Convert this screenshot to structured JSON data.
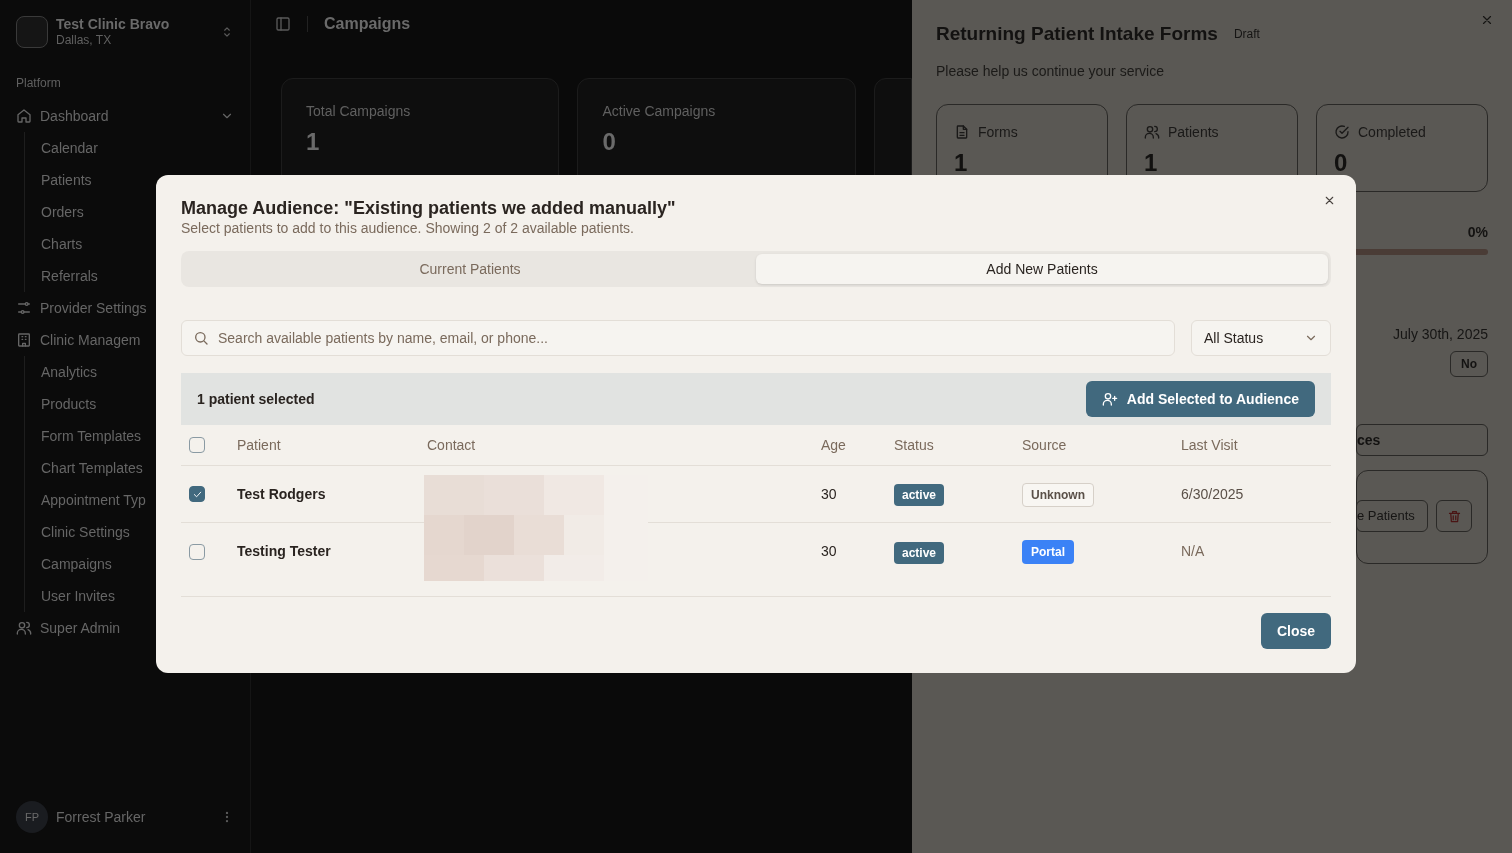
{
  "sidebar": {
    "clinic": {
      "name": "Test Clinic Bravo",
      "location": "Dallas, TX"
    },
    "section_label": "Platform",
    "items": [
      {
        "label": "Dashboard",
        "expanded": true,
        "children": [
          {
            "label": "Calendar"
          },
          {
            "label": "Patients"
          },
          {
            "label": "Orders"
          },
          {
            "label": "Charts"
          },
          {
            "label": "Referrals"
          }
        ]
      },
      {
        "label": "Provider Settings"
      },
      {
        "label": "Clinic Managem",
        "children": [
          {
            "label": "Analytics"
          },
          {
            "label": "Products"
          },
          {
            "label": "Form Templates"
          },
          {
            "label": "Chart Templates"
          },
          {
            "label": "Appointment Typ"
          },
          {
            "label": "Clinic Settings"
          },
          {
            "label": "Campaigns"
          },
          {
            "label": "User Invites"
          }
        ]
      },
      {
        "label": "Super Admin"
      }
    ],
    "user": {
      "initials": "FP",
      "name": "Forrest Parker"
    }
  },
  "header": {
    "title": "Campaigns"
  },
  "stats": [
    {
      "label": "Total Campaigns",
      "value": "1"
    },
    {
      "label": "Active Campaigns",
      "value": "0"
    }
  ],
  "sheet": {
    "title": "Returning Patient Intake Forms",
    "badge": "Draft",
    "description": "Please help us continue your service",
    "cards": [
      {
        "label": "Forms",
        "value": "1"
      },
      {
        "label": "Patients",
        "value": "1"
      },
      {
        "label": "Completed",
        "value": "0"
      }
    ],
    "progress": {
      "reading": "0%",
      "level": 0
    },
    "date": "July 30th, 2025",
    "flag": "No",
    "section_fragment": "ces",
    "button_fragment": "e Patients"
  },
  "modal": {
    "title": "Manage Audience: \"Existing patients we added manually\"",
    "subtitle": "Select patients to add to this audience. Showing 2 of 2 available patients.",
    "tabs": [
      {
        "label": "Current Patients",
        "selected": false
      },
      {
        "label": "Add New Patients",
        "selected": true
      }
    ],
    "search": {
      "placeholder": "Search available patients by name, email, or phone..."
    },
    "status_filter": "All Status",
    "selection_text": "1 patient selected",
    "add_button": "Add Selected to Audience",
    "select_all": false,
    "columns": [
      "Patient",
      "Contact",
      "Age",
      "Status",
      "Source",
      "Last Visit"
    ],
    "rows": [
      {
        "selected": true,
        "patient": "Test Rodgers",
        "age": "30",
        "status": "active",
        "source": "Unknown",
        "color": "#f8f6f2",
        "last_visit": "6/30/2025"
      },
      {
        "selected": false,
        "patient": "Testing Tester",
        "age": "30",
        "status": "active",
        "source": "Portal",
        "color": "#3b82f6",
        "last_visit": "N/A"
      }
    ],
    "close_button": "Close"
  }
}
